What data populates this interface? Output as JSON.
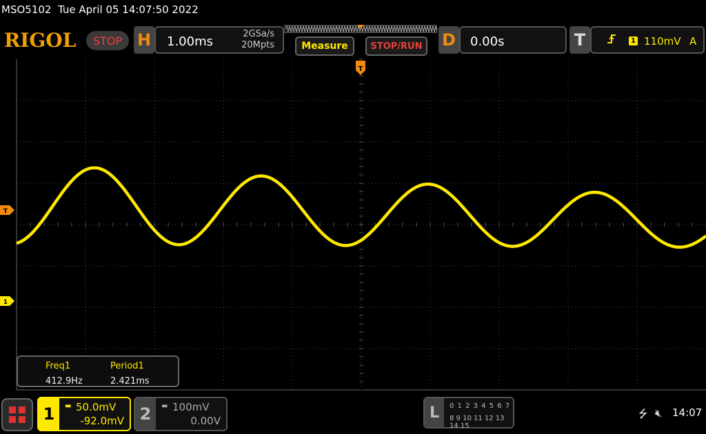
{
  "header": {
    "model": "MSO5102",
    "datetime": "Tue April 05 14:07:50 2022",
    "brand": "RIGOL",
    "run_state": "STOP"
  },
  "horizontal": {
    "tab": "H",
    "timebase": "1.00ms",
    "sample_rate": "2GSa/s",
    "memory_depth": "20Mpts"
  },
  "buttons": {
    "measure": "Measure",
    "stop_run": "STOP/RUN"
  },
  "delay": {
    "tab": "D",
    "value": "0.00s"
  },
  "trigger": {
    "tab": "T",
    "source": "1",
    "level": "110mV",
    "mode": "A",
    "edge_icon": "rising-edge-icon"
  },
  "markers": {
    "trigger_position": "T",
    "trigger_level": "T",
    "ch1_ground": "1"
  },
  "measurements": [
    {
      "label": "Freq1",
      "value": "412.9Hz"
    },
    {
      "label": "Period1",
      "value": "2.421ms"
    }
  ],
  "channels": [
    {
      "number": "1",
      "scale": "50.0mV",
      "offset": "-92.0mV",
      "color": "#ffe800"
    },
    {
      "number": "2",
      "scale": "100mV",
      "offset": "0.00V",
      "color": "#aaaaaa"
    }
  ],
  "logic": {
    "tab": "L",
    "row1": "0 1 2 3  4 5 6 7",
    "row2": "8 9 10 11 12 13 14 15"
  },
  "status": {
    "usb_icon": "usb-icon",
    "sound_icon": "speaker-muted-icon",
    "clock": "14:07"
  },
  "colors": {
    "brand": "#f0a000",
    "ch1": "#ffe800",
    "stop": "#e8403a",
    "trigger_marker": "#f08a10"
  },
  "waveform": {
    "frequency_hz": 412.9,
    "period_ms": 2.421
  }
}
